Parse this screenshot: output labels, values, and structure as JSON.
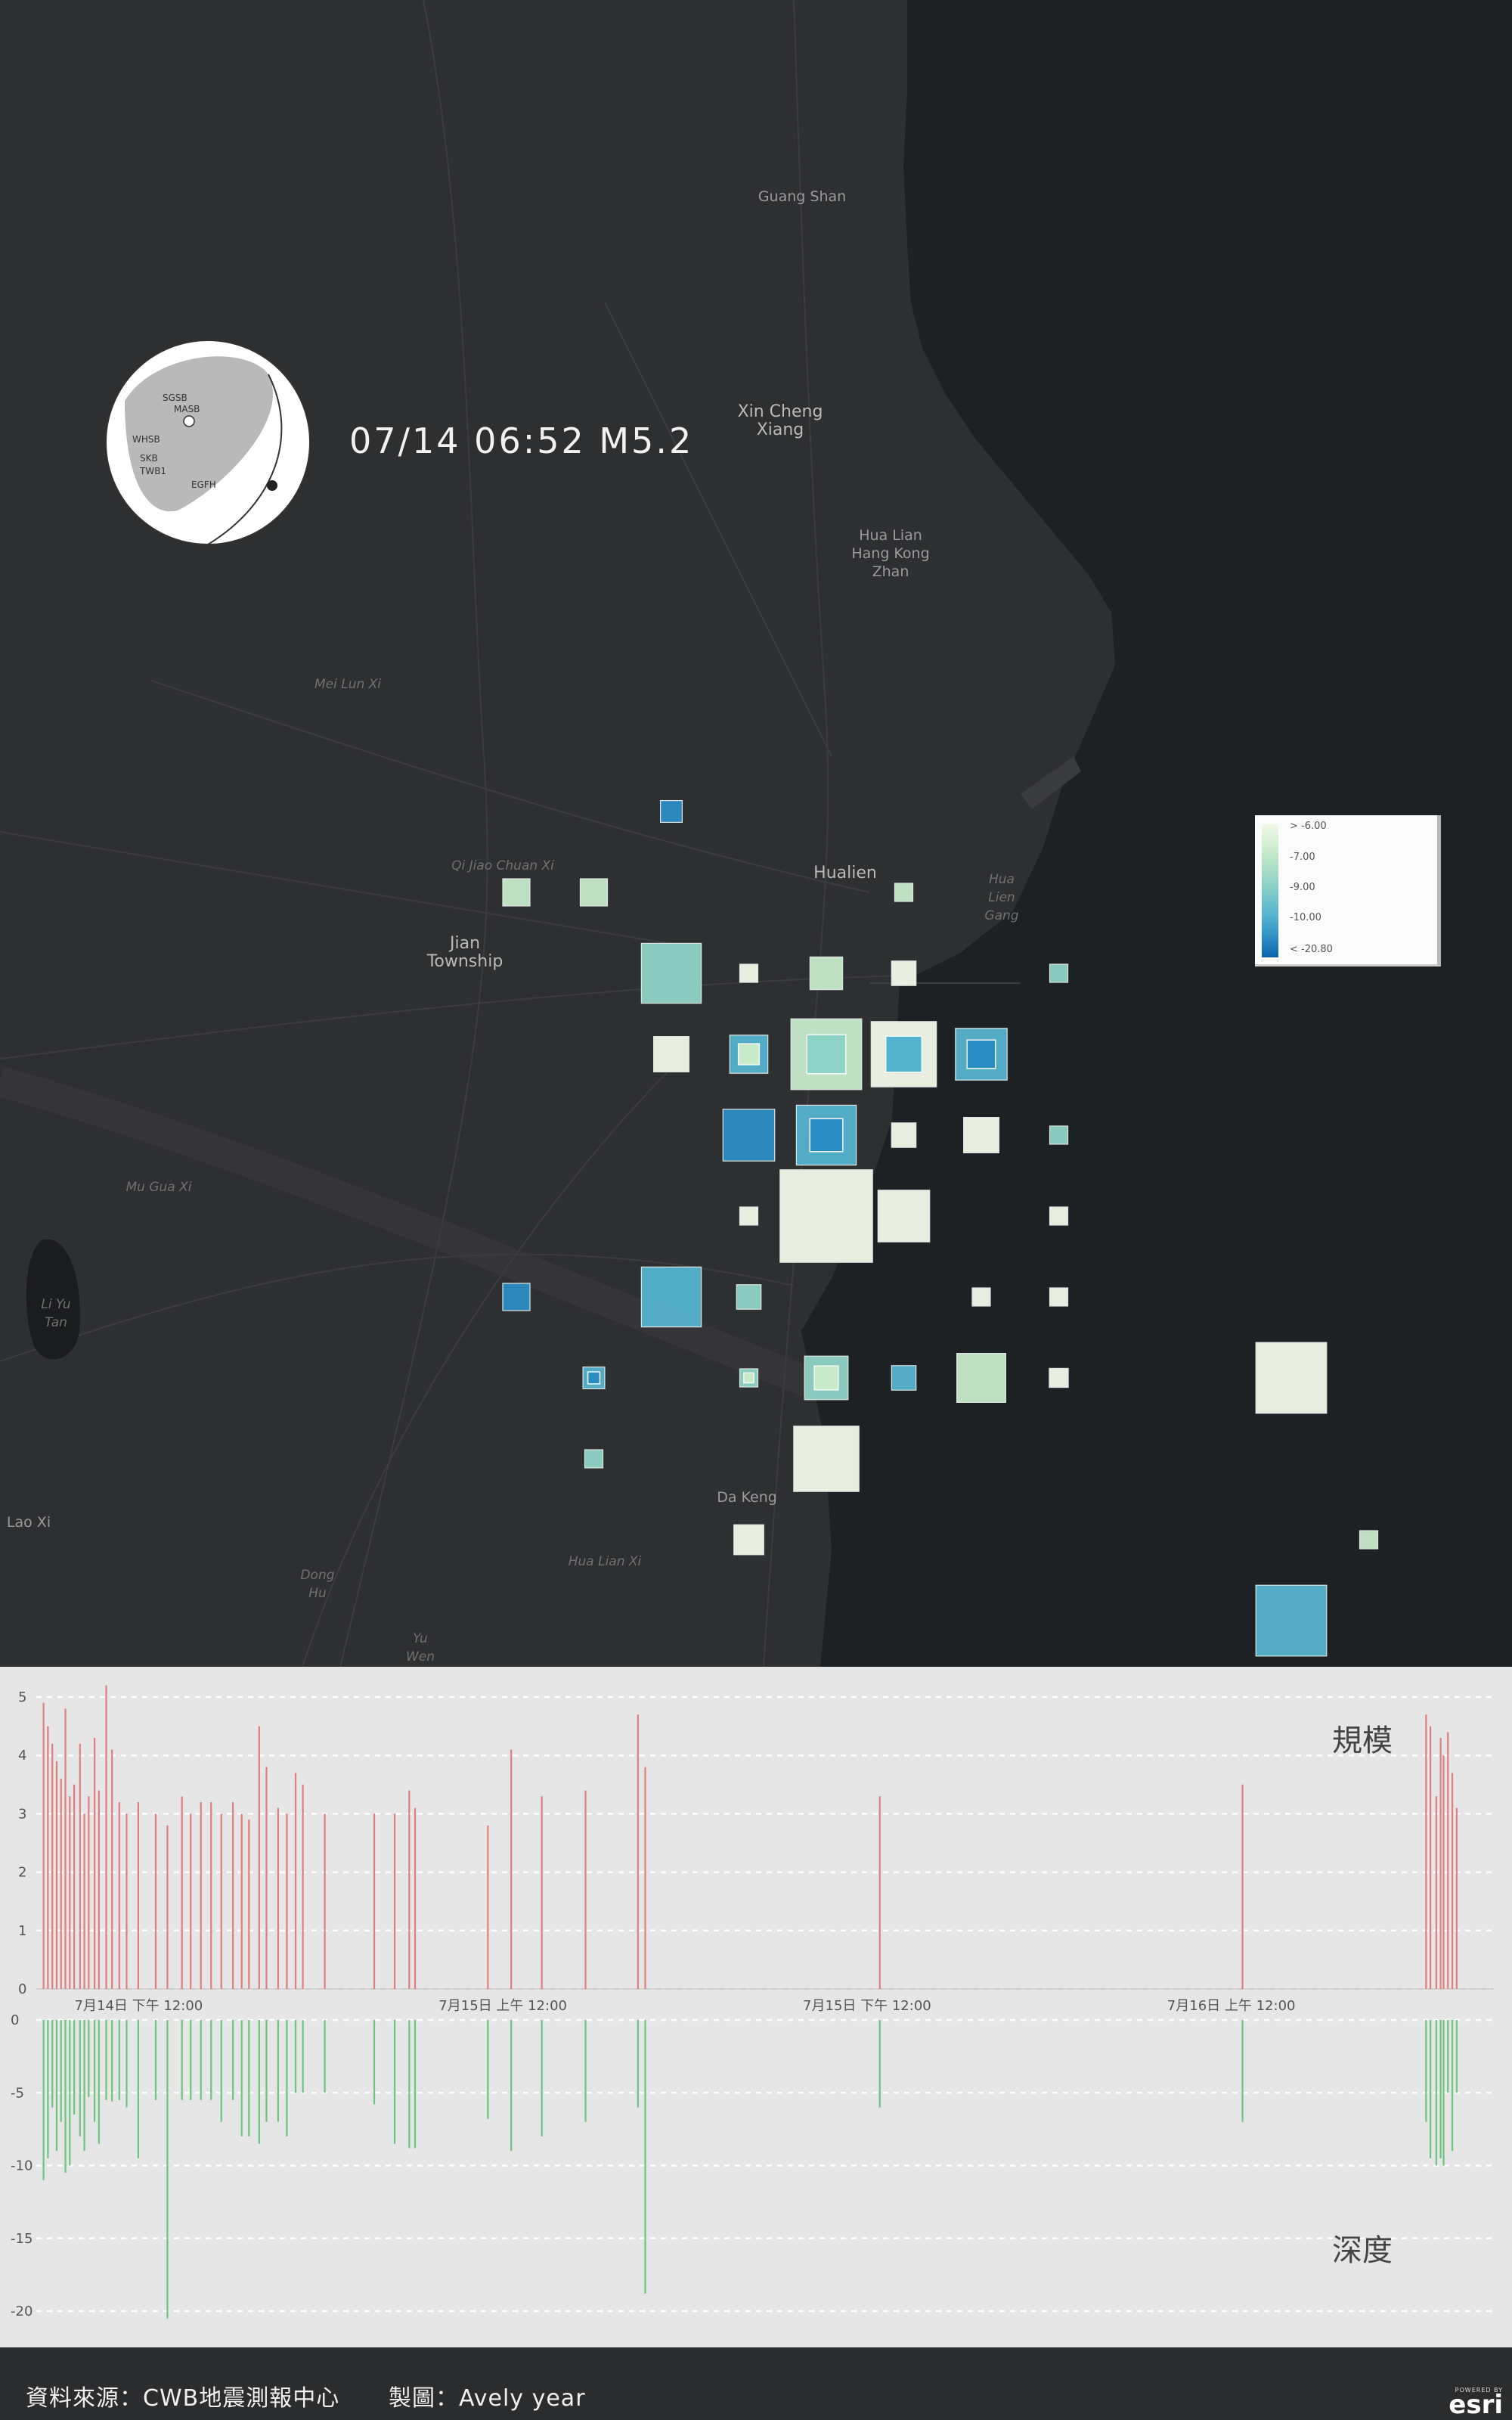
{
  "map": {
    "places": [
      {
        "label": "Guang Shan",
        "cls": "",
        "x": 1061,
        "y": 260
      },
      {
        "label": "Xin Cheng\nXiang",
        "cls": "big",
        "x": 1032,
        "y": 545
      },
      {
        "label": "Hua Lian\nHang Kong\nZhan",
        "cls": "",
        "x": 1178,
        "y": 708
      },
      {
        "label": "Jian\nTownship",
        "cls": "big",
        "x": 615,
        "y": 1248
      },
      {
        "label": "Hualien",
        "cls": "big",
        "x": 1118,
        "y": 1155
      },
      {
        "label": "Hua\nLien\nGang",
        "cls": "dim",
        "x": 1325,
        "y": 1163
      },
      {
        "label": "Li Yu\nTan",
        "cls": "dim",
        "x": 74,
        "y": 1725
      },
      {
        "label": "Da Keng",
        "cls": "",
        "x": 988,
        "y": 1980
      },
      {
        "label": "Lao Xi",
        "cls": "",
        "x": 38,
        "y": 2013
      },
      {
        "label": "Dong\nHu",
        "cls": "dim",
        "x": 420,
        "y": 2083
      },
      {
        "label": "Yu\nWen",
        "cls": "dim",
        "x": 556,
        "y": 2167
      },
      {
        "label": "Mei Lun Xi",
        "cls": "dim",
        "x": 460,
        "y": 905
      },
      {
        "label": "Qi Jiao Chuan Xi",
        "cls": "dim",
        "x": 665,
        "y": 1145
      },
      {
        "label": "Mu Gua Xi",
        "cls": "dim",
        "x": 210,
        "y": 1570
      },
      {
        "label": "Hua Lian Xi",
        "cls": "dim",
        "x": 800,
        "y": 2065
      }
    ],
    "event_label": "07/14 06:52 M5.2",
    "beachball_labels": [
      "SGSB",
      "MASB",
      "WHSB",
      "SKB",
      "TWB1",
      "EGFH"
    ],
    "legend": {
      "items": [
        "> -6.00",
        "-7.00",
        "-9.00",
        "-10.00",
        "< -20.80"
      ],
      "colors": [
        "#f3f9ea",
        "#c8eacb",
        "#8fd3c7",
        "#56b3cf",
        "#2b8cc4",
        "#0a64ad"
      ]
    },
    "grid_cells": [
      {
        "col": 7,
        "row": 2,
        "mag": 3.4,
        "depth": -11
      },
      {
        "col": 5,
        "row": 3,
        "mag": 3.6,
        "depth": -7.5
      },
      {
        "col": 6,
        "row": 3,
        "mag": 3.6,
        "depth": -7.5
      },
      {
        "col": 10,
        "row": 3,
        "mag": 3.2,
        "depth": -7.5
      },
      {
        "col": 7,
        "row": 4,
        "mag": 4.8,
        "depth": -8.8
      },
      {
        "col": 8,
        "row": 4,
        "mag": 3.0,
        "depth": -5.5
      },
      {
        "col": 9,
        "row": 4,
        "mag": 3.8,
        "depth": -7.2
      },
      {
        "col": 10,
        "row": 4,
        "mag": 3.5,
        "depth": -5.5
      },
      {
        "col": 12,
        "row": 4,
        "mag": 3.1,
        "depth": -8
      },
      {
        "col": 7,
        "row": 5,
        "mag": 3.9,
        "depth": -5.5
      },
      {
        "col": 8,
        "row": 5,
        "mag": 4.0,
        "depth": -10.5,
        "inner": -6
      },
      {
        "col": 9,
        "row": 5,
        "mag": 5.2,
        "depth": -6.5,
        "inner": -8
      },
      {
        "col": 10,
        "row": 5,
        "mag": 5.0,
        "depth": -5.2,
        "inner": -9.5
      },
      {
        "col": 11,
        "row": 5,
        "mag": 4.5,
        "depth": -9.5,
        "inner": -10.8
      },
      {
        "col": 8,
        "row": 6,
        "mag": 4.5,
        "depth": -11
      },
      {
        "col": 9,
        "row": 6,
        "mag": 4.8,
        "depth": -9.3,
        "inner": -11.2
      },
      {
        "col": 10,
        "row": 6,
        "mag": 3.5,
        "depth": -5.5
      },
      {
        "col": 11,
        "row": 6,
        "mag": 3.9,
        "depth": -5.5
      },
      {
        "col": 12,
        "row": 6,
        "mag": 3.1,
        "depth": -8
      },
      {
        "col": 8,
        "row": 7,
        "mag": 2.8,
        "depth": -5.5
      },
      {
        "col": 9,
        "row": 7,
        "mag": 6.0,
        "depth": -5.3
      },
      {
        "col": 10,
        "row": 7,
        "mag": 4.5,
        "depth": -5.5
      },
      {
        "col": 12,
        "row": 7,
        "mag": 3.0,
        "depth": -5.5
      },
      {
        "col": 5,
        "row": 8,
        "mag": 3.6,
        "depth": -11
      },
      {
        "col": 7,
        "row": 8,
        "mag": 4.8,
        "depth": -9.8
      },
      {
        "col": 8,
        "row": 8,
        "mag": 3.5,
        "depth": -8
      },
      {
        "col": 11,
        "row": 8,
        "mag": 2.8,
        "depth": -5.5
      },
      {
        "col": 12,
        "row": 8,
        "mag": 2.8,
        "depth": -5.5
      },
      {
        "col": 6,
        "row": 9,
        "mag": 3.4,
        "depth": -10.5,
        "inner": -11.5
      },
      {
        "col": 8,
        "row": 9,
        "mag": 3.2,
        "depth": -8,
        "inner": -7
      },
      {
        "col": 9,
        "row": 9,
        "mag": 4.2,
        "depth": -9,
        "inner": -7
      },
      {
        "col": 10,
        "row": 9,
        "mag": 3.5,
        "depth": -9.5
      },
      {
        "col": 11,
        "row": 9,
        "mag": 4.4,
        "depth": -7.2
      },
      {
        "col": 12,
        "row": 9,
        "mag": 3.3,
        "depth": -5.5
      },
      {
        "col": 15,
        "row": 9,
        "mag": 5.2,
        "depth": -5.5
      },
      {
        "col": 6,
        "row": 10,
        "mag": 3.0,
        "depth": -8
      },
      {
        "col": 9,
        "row": 10,
        "mag": 5.0,
        "depth": -5.5
      },
      {
        "col": 8,
        "row": 11,
        "mag": 3.7,
        "depth": -5.5
      },
      {
        "col": 16,
        "row": 11,
        "mag": 3.2,
        "depth": -7.2
      },
      {
        "col": 15,
        "row": 12,
        "mag": 5.2,
        "depth": -9.8
      }
    ]
  },
  "chart_data": {
    "type": "bar",
    "x_ticks": [
      "7月14日 下午 12:00",
      "7月15日 上午 12:00",
      "7月15日 下午 12:00",
      "7月16日 上午 12:00"
    ],
    "x_tick_positions": [
      0.2,
      0.45,
      0.7,
      0.95
    ],
    "series": [
      {
        "name": "規模",
        "color": "#e07e7e",
        "ylim": [
          0,
          5
        ],
        "yticks": [
          0,
          1,
          2,
          3,
          4,
          5
        ],
        "points": [
          [
            0.005,
            4.9
          ],
          [
            0.008,
            4.5
          ],
          [
            0.011,
            4.2
          ],
          [
            0.014,
            3.9
          ],
          [
            0.017,
            3.6
          ],
          [
            0.02,
            4.8
          ],
          [
            0.023,
            3.3
          ],
          [
            0.026,
            3.5
          ],
          [
            0.03,
            4.2
          ],
          [
            0.033,
            3.0
          ],
          [
            0.036,
            3.3
          ],
          [
            0.04,
            4.3
          ],
          [
            0.043,
            3.4
          ],
          [
            0.048,
            5.2
          ],
          [
            0.052,
            4.1
          ],
          [
            0.057,
            3.2
          ],
          [
            0.062,
            3.0
          ],
          [
            0.07,
            3.2
          ],
          [
            0.082,
            3.0
          ],
          [
            0.09,
            2.8
          ],
          [
            0.1,
            3.3
          ],
          [
            0.106,
            3.0
          ],
          [
            0.113,
            3.2
          ],
          [
            0.12,
            3.2
          ],
          [
            0.127,
            3.0
          ],
          [
            0.135,
            3.2
          ],
          [
            0.141,
            3.0
          ],
          [
            0.146,
            2.9
          ],
          [
            0.153,
            4.5
          ],
          [
            0.158,
            3.8
          ],
          [
            0.166,
            3.1
          ],
          [
            0.172,
            3.0
          ],
          [
            0.178,
            3.7
          ],
          [
            0.183,
            3.5
          ],
          [
            0.198,
            3.0
          ],
          [
            0.232,
            3.0
          ],
          [
            0.246,
            3.0
          ],
          [
            0.256,
            3.4
          ],
          [
            0.26,
            3.1
          ],
          [
            0.31,
            2.8
          ],
          [
            0.326,
            4.1
          ],
          [
            0.347,
            3.3
          ],
          [
            0.377,
            3.4
          ],
          [
            0.413,
            4.7
          ],
          [
            0.418,
            3.8
          ],
          [
            0.579,
            3.3
          ],
          [
            0.828,
            3.5
          ],
          [
            0.954,
            4.7
          ],
          [
            0.957,
            4.5
          ],
          [
            0.961,
            3.3
          ],
          [
            0.964,
            4.3
          ],
          [
            0.966,
            4.0
          ],
          [
            0.969,
            4.4
          ],
          [
            0.972,
            3.7
          ],
          [
            0.975,
            3.1
          ]
        ]
      },
      {
        "name": "深度",
        "color": "#6cc47e",
        "ylim": [
          -20,
          0
        ],
        "yticks": [
          0,
          -5,
          -10,
          -15,
          -20
        ],
        "points": [
          [
            0.005,
            -11
          ],
          [
            0.008,
            -9.5
          ],
          [
            0.011,
            -6
          ],
          [
            0.014,
            -9
          ],
          [
            0.017,
            -7
          ],
          [
            0.02,
            -10.5
          ],
          [
            0.023,
            -10
          ],
          [
            0.026,
            -6.5
          ],
          [
            0.03,
            -8
          ],
          [
            0.033,
            -9
          ],
          [
            0.036,
            -5.3
          ],
          [
            0.04,
            -7
          ],
          [
            0.043,
            -8.5
          ],
          [
            0.048,
            -5.5
          ],
          [
            0.052,
            -5.6
          ],
          [
            0.057,
            -5.5
          ],
          [
            0.062,
            -6
          ],
          [
            0.07,
            -9.5
          ],
          [
            0.082,
            -5.5
          ],
          [
            0.09,
            -20.5
          ],
          [
            0.1,
            -5.5
          ],
          [
            0.106,
            -5.5
          ],
          [
            0.113,
            -5.5
          ],
          [
            0.12,
            -5.5
          ],
          [
            0.127,
            -7
          ],
          [
            0.135,
            -5.5
          ],
          [
            0.141,
            -8
          ],
          [
            0.146,
            -8
          ],
          [
            0.153,
            -8.5
          ],
          [
            0.158,
            -7
          ],
          [
            0.166,
            -7
          ],
          [
            0.172,
            -8
          ],
          [
            0.178,
            -5
          ],
          [
            0.183,
            -5
          ],
          [
            0.198,
            -5
          ],
          [
            0.232,
            -5.8
          ],
          [
            0.246,
            -8.5
          ],
          [
            0.256,
            -8.8
          ],
          [
            0.26,
            -8.8
          ],
          [
            0.31,
            -6.8
          ],
          [
            0.326,
            -9
          ],
          [
            0.347,
            -8
          ],
          [
            0.377,
            -7
          ],
          [
            0.413,
            -6
          ],
          [
            0.418,
            -18.8
          ],
          [
            0.579,
            -6
          ],
          [
            0.828,
            -7
          ],
          [
            0.954,
            -7
          ],
          [
            0.957,
            -9.5
          ],
          [
            0.961,
            -10
          ],
          [
            0.964,
            -9.5
          ],
          [
            0.966,
            -10
          ],
          [
            0.969,
            -5
          ],
          [
            0.972,
            -9
          ],
          [
            0.975,
            -5
          ]
        ]
      }
    ]
  },
  "footer": {
    "source": "資料來源：CWB地震測報中心",
    "maker": "製圖：Avely year",
    "powered": "POWERED BY",
    "brand": "esri"
  }
}
